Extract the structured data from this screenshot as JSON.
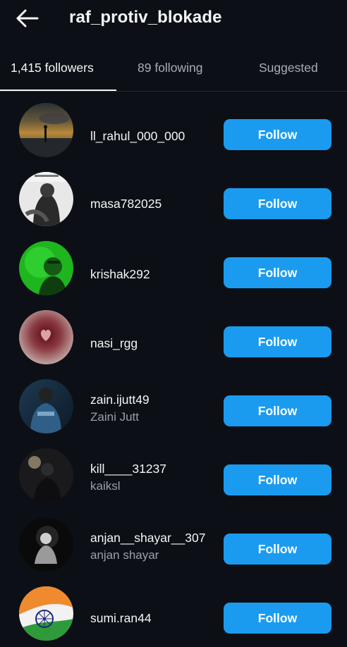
{
  "header": {
    "back_icon": "arrow-left-icon",
    "username": "raf_protiv_blokade"
  },
  "tabs": [
    {
      "label": "1,415 followers",
      "active": true
    },
    {
      "label": "89 following",
      "active": false
    },
    {
      "label": "Suggested",
      "active": false
    }
  ],
  "followers": [
    {
      "username": "ll_rahul_000_000",
      "full_name": "",
      "button": "Follow",
      "avatar": "sunset-silhouette"
    },
    {
      "username": "masa782025",
      "full_name": "",
      "button": "Follow",
      "avatar": "bw-hooded-figure"
    },
    {
      "username": "krishak292",
      "full_name": "",
      "button": "Follow",
      "avatar": "green-selfie"
    },
    {
      "username": "nasi_rgg",
      "full_name": "",
      "button": "Follow",
      "avatar": "red-heart"
    },
    {
      "username": "zain.ijutt49",
      "full_name": "Zaini Jutt",
      "button": "Follow",
      "avatar": "blue-jacket-zain"
    },
    {
      "username": "kill____31237",
      "full_name": "kaiksl",
      "button": "Follow",
      "avatar": "dark-figure"
    },
    {
      "username": "anjan__shayar__307",
      "full_name": "anjan shayar",
      "button": "Follow",
      "avatar": "bw-sad-figure"
    },
    {
      "username": "sumi.ran44",
      "full_name": "",
      "button": "Follow",
      "avatar": "indian-flag-emblem"
    }
  ],
  "colors": {
    "background": "#0c1016",
    "follow_button": "#1a9bf0",
    "secondary_text": "#9aa0a8"
  }
}
